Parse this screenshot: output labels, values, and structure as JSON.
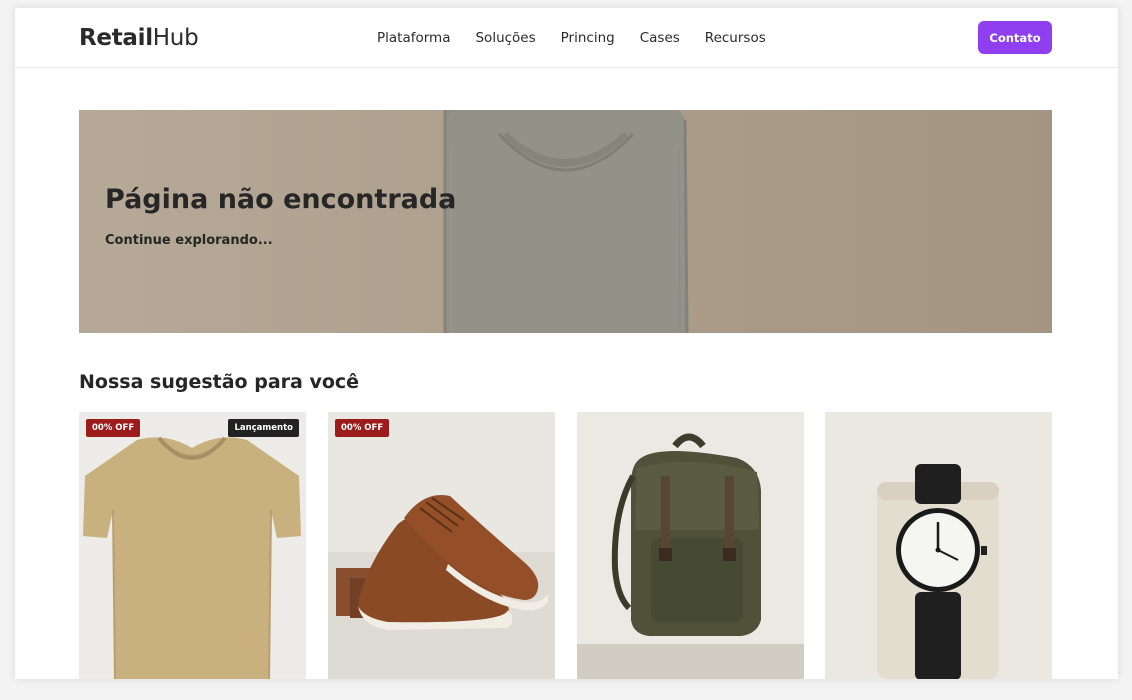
{
  "brand": {
    "bold": "Retail",
    "light": "Hub"
  },
  "nav": {
    "items": [
      {
        "label": "Plataforma"
      },
      {
        "label": "Soluções"
      },
      {
        "label": "Princing"
      },
      {
        "label": "Cases"
      },
      {
        "label": "Recursos"
      }
    ],
    "cta_label": "Contato"
  },
  "hero": {
    "title": "Página não encontrada",
    "subtitle": "Continue explorando...",
    "image_subject": "folded gray t-shirt"
  },
  "suggestions": {
    "title": "Nossa sugestão para você",
    "products": [
      {
        "image": "beige t-shirt",
        "discount_badge": "00% OFF",
        "launch_badge": "Lançamento"
      },
      {
        "image": "brown leather sneakers",
        "discount_badge": "00% OFF"
      },
      {
        "image": "olive green backpack"
      },
      {
        "image": "black wrist watch"
      }
    ]
  },
  "colors": {
    "accent": "#8f3ff0",
    "discount_badge": "#9c1c1c",
    "launch_badge": "#222222",
    "hero_bg": "#b0a28f"
  }
}
